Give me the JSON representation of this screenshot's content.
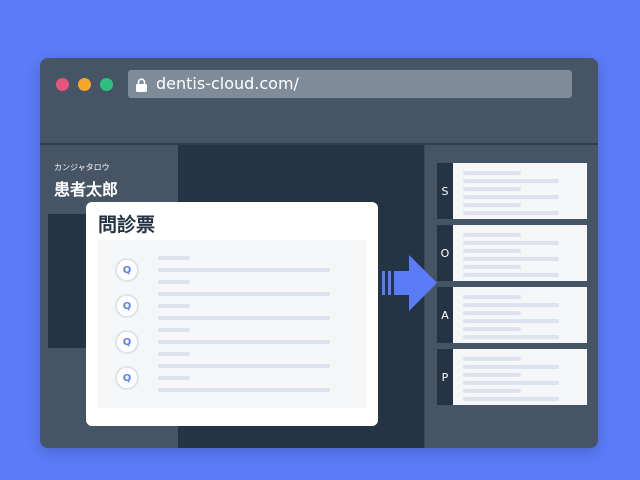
{
  "browser": {
    "url": "dentis-cloud.com/",
    "lock_icon": "lock-icon",
    "window_controls": [
      "close-dot",
      "minimize-dot",
      "maximize-dot"
    ]
  },
  "patient": {
    "kana": "カンジャタロウ",
    "name": "患者太郎"
  },
  "questionnaire": {
    "title": "問診票",
    "questions": [
      {
        "badge": "Q"
      },
      {
        "badge": "Q"
      },
      {
        "badge": "Q"
      },
      {
        "badge": "Q"
      }
    ]
  },
  "soap": {
    "rows": [
      {
        "label": "S"
      },
      {
        "label": "O"
      },
      {
        "label": "A"
      },
      {
        "label": "P"
      }
    ]
  },
  "flow_icon": "arrow-right-icon",
  "colors": {
    "background": "#5b7cf7",
    "window": "#465566",
    "dark_panel": "#243445",
    "accent": "#5b7cf7",
    "close": "#e8537a",
    "minimize": "#f4a62a",
    "maximize": "#2fbf7e"
  }
}
